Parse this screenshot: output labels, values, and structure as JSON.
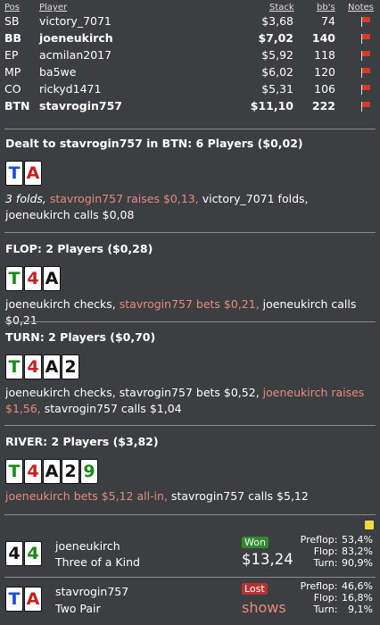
{
  "header": {
    "pos": "Pos",
    "player": "Player",
    "stack": "Stack",
    "bb": "bb's",
    "notes": "Notes"
  },
  "seats": [
    {
      "pos": "SB",
      "player": "victory_7071",
      "stack": "$3,68",
      "bb": "74",
      "bold": false
    },
    {
      "pos": "BB",
      "player": "joeneukirch",
      "stack": "$7,02",
      "bb": "140",
      "bold": true
    },
    {
      "pos": "EP",
      "player": "acmilan2017",
      "stack": "$5,92",
      "bb": "118",
      "bold": false
    },
    {
      "pos": "MP",
      "player": "ba5we",
      "stack": "$6,02",
      "bb": "120",
      "bold": false
    },
    {
      "pos": "CO",
      "player": "rickyd1471",
      "stack": "$5,31",
      "bb": "106",
      "bold": false
    },
    {
      "pos": "BTN",
      "player": "stavrogin757",
      "stack": "$11,10",
      "bb": "222",
      "bold": true
    }
  ],
  "colors": {
    "spade": "#111111",
    "club": "#1a8a1a",
    "diamond": "#1a4fd0",
    "heart": "#cc1e1e",
    "highlight": "#e88a7c"
  },
  "preflop": {
    "title": "Dealt to stavrogin757 in BTN: 6 Players ($0,02)",
    "cards": [
      {
        "r": "T",
        "s": "diamond"
      },
      {
        "r": "A",
        "s": "heart"
      }
    ],
    "a1": "3 folds,",
    "a2": " stavrogin757 raises $0,13,",
    "a3": " victory_7071 folds, joeneukirch calls $0,08"
  },
  "flop": {
    "title": "FLOP: 2 Players ($0,28)",
    "cards": [
      {
        "r": "T",
        "s": "club"
      },
      {
        "r": "4",
        "s": "heart"
      },
      {
        "r": "A",
        "s": "spade"
      }
    ],
    "a1": "joeneukirch checks,",
    "a2": " stavrogin757 bets $0,21,",
    "a3": " joeneukirch calls $0,21"
  },
  "turn": {
    "title": "TURN: 2 Players ($0,70)",
    "cards": [
      {
        "r": "T",
        "s": "club"
      },
      {
        "r": "4",
        "s": "heart"
      },
      {
        "r": "A",
        "s": "spade"
      },
      {
        "r": "2",
        "s": "spade"
      }
    ],
    "a1": "joeneukirch checks, stavrogin757 bets $0,52,",
    "a2": " joeneukirch raises $1,56,",
    "a3": " stavrogin757 calls $1,04"
  },
  "river": {
    "title": "RIVER: 2 Players ($3,82)",
    "cards": [
      {
        "r": "T",
        "s": "club"
      },
      {
        "r": "4",
        "s": "heart"
      },
      {
        "r": "A",
        "s": "spade"
      },
      {
        "r": "2",
        "s": "spade"
      },
      {
        "r": "9",
        "s": "club"
      }
    ],
    "a1": "joeneukirch bets $5,12 all-in,",
    "a2": " stavrogin757 calls $5,12"
  },
  "results": [
    {
      "cards": [
        {
          "r": "4",
          "s": "spade"
        },
        {
          "r": "4",
          "s": "club"
        }
      ],
      "name": "joeneukirch",
      "hand": "Three of a Kind",
      "badge": "Won",
      "amount": "$13,24",
      "eq": [
        {
          "l": "Preflop:",
          "v": "53,4%"
        },
        {
          "l": "Flop:",
          "v": "83,2%"
        },
        {
          "l": "Turn:",
          "v": "90,9%"
        }
      ]
    },
    {
      "cards": [
        {
          "r": "T",
          "s": "diamond"
        },
        {
          "r": "A",
          "s": "heart"
        }
      ],
      "name": "stavrogin757",
      "hand": "Two Pair",
      "badge": "Lost",
      "amount": "shows",
      "eq": [
        {
          "l": "Preflop:",
          "v": "46,6%"
        },
        {
          "l": "Flop:",
          "v": "16,8%"
        },
        {
          "l": "Turn:",
          "v": "9,1%"
        }
      ]
    }
  ]
}
